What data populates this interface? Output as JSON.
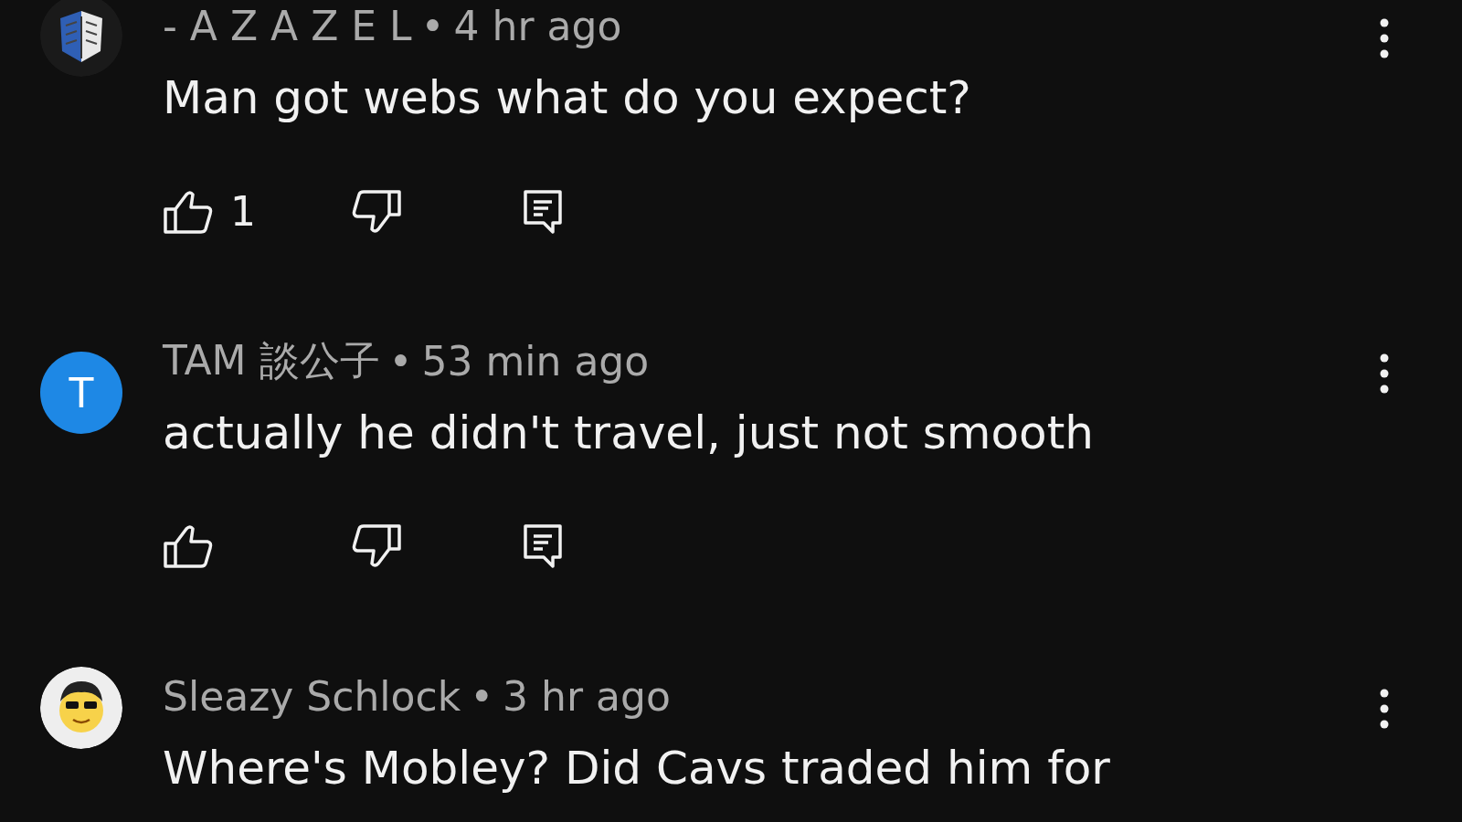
{
  "comments": [
    {
      "avatar": {
        "kind": "image"
      },
      "author": "- A Z A Z E L",
      "separator": "•",
      "time": "4 hr ago",
      "text": "Man got webs what do you expect?",
      "likes": "1"
    },
    {
      "avatar": {
        "kind": "letter",
        "letter": "T",
        "color": "#1e88e5"
      },
      "author": "TAM 談公子",
      "separator": "•",
      "time": "53 min ago",
      "text": "actually he didn't travel, just not smooth"
    },
    {
      "avatar": {
        "kind": "face"
      },
      "author": "Sleazy Schlock",
      "separator": "•",
      "time": "3 hr ago",
      "text": "Where's Mobley? Did Cavs traded him for"
    }
  ]
}
